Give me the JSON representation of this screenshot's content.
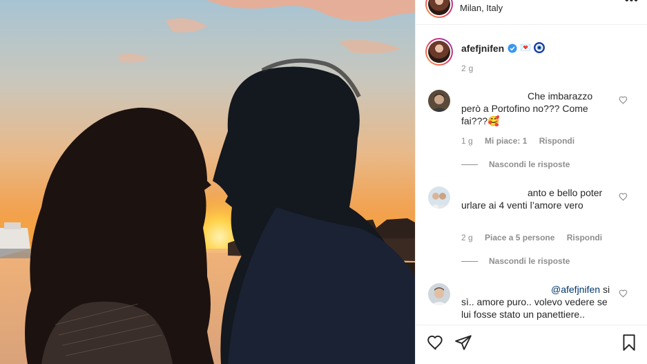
{
  "post": {
    "location": "Milan, Italy",
    "author": "afefjnifen",
    "author_emoji": "💌",
    "time": "2 g"
  },
  "comments": [
    {
      "text": "Che imbarazzo però a Portofino no??? Come fai???🥰",
      "time": "1 g",
      "likes_label": "Mi piace: 1",
      "reply_label": "Rispondi",
      "hide_replies": "Nascondi le risposte"
    },
    {
      "text": "anto e bello poter urlare ai 4 venti l’amore vero",
      "time": "2 g",
      "likes_label": "Piace a 5 persone",
      "reply_label": "Rispondi",
      "hide_replies": "Nascondi le risposte"
    },
    {
      "mention": "@afefjnifen",
      "text": "si sì.. amore puro.. volevo vedere se lui fosse stato un panettiere.."
    }
  ],
  "icons": {
    "more": "more-options-icon",
    "verified": "verified-badge-icon",
    "like": "heart-icon",
    "share": "share-icon",
    "save": "bookmark-icon"
  },
  "colors": {
    "verified": "#3897f0",
    "meta": "#8e8e8e",
    "mention": "#00376b"
  }
}
